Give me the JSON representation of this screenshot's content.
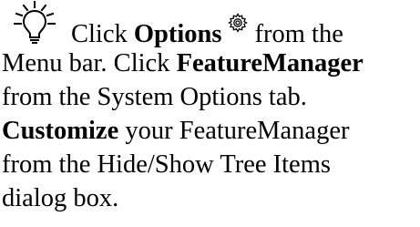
{
  "tip": {
    "icons": {
      "tip_icon": "lightbulb-icon",
      "options_icon": "gear-icon"
    },
    "line1": {
      "prefix": "Click ",
      "bold": "Options",
      "suffix": "from the"
    },
    "line2": "Menu bar. Click ",
    "line2_bold": "FeatureManager",
    "line3": "from the System Options tab.",
    "line4_bold": "Customize",
    "line4": " your FeatureManager",
    "line5": "from the Hide/Show Tree Items",
    "line6": "dialog box."
  }
}
